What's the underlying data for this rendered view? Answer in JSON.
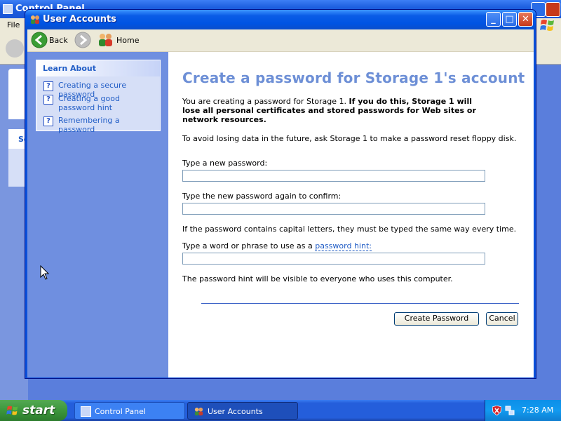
{
  "background_window": {
    "title": "Control Panel",
    "menu_first": "File",
    "panel_header": "Se"
  },
  "window": {
    "title": "User Accounts",
    "controls": {
      "minimize": "_",
      "maximize": "□",
      "close": "✕"
    }
  },
  "navbar": {
    "back_label": "Back",
    "home_label": "Home"
  },
  "sidebar": {
    "header": "Learn About",
    "links": [
      {
        "label": "Creating a secure password",
        "icon": "help-icon"
      },
      {
        "label": "Creating a good password hint",
        "icon": "help-icon"
      },
      {
        "label": "Remembering a password",
        "icon": "help-icon"
      }
    ]
  },
  "main": {
    "heading": "Create a password for Storage 1's account",
    "intro_plain": "You are creating a password for Storage 1. ",
    "intro_bold": "If you do this, Storage 1 will lose all personal certificates and stored passwords for Web sites or network resources.",
    "reset_note": "To avoid losing data in the future, ask Storage 1 to make a password reset floppy disk.",
    "new_password_label": "Type a new password:",
    "new_password_value": "",
    "confirm_label": "Type the new password again to confirm:",
    "confirm_value": "",
    "caps_note": "If the password contains capital letters, they must be typed the same way every time.",
    "hint_label_prefix": "Type a word or phrase to use as a ",
    "hint_link": "password hint:",
    "hint_value": "",
    "hint_visibility_note": "The password hint will be visible to everyone who uses this computer.",
    "create_button": "Create Password",
    "cancel_button": "Cancel"
  },
  "taskbar": {
    "start_label": "start",
    "tasks": [
      {
        "label": "Control Panel",
        "active": false
      },
      {
        "label": "User Accounts",
        "active": true
      }
    ],
    "clock": "7:28 AM"
  },
  "colors": {
    "titlebar": "#0054e3",
    "heading": "#6d8fd6",
    "sidebar": "#6f8fe0",
    "link": "#215dc6"
  }
}
